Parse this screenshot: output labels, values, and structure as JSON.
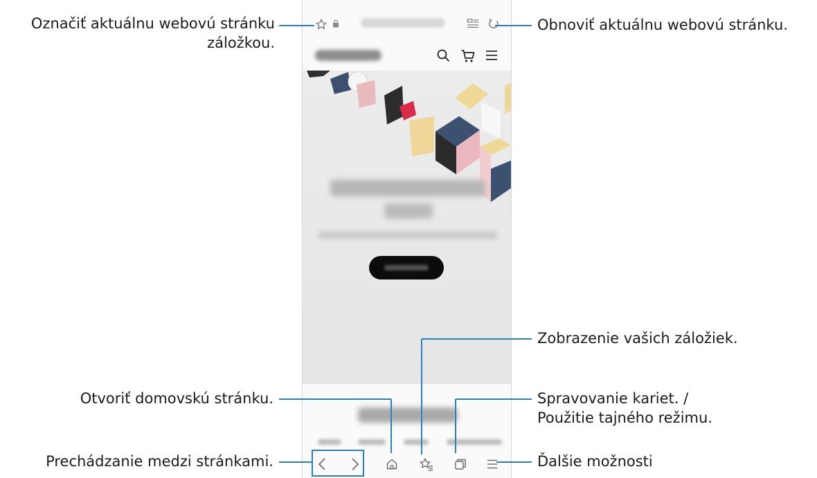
{
  "callouts": {
    "bookmark_current": "Označiť aktuálnu webovú stránku záložkou.",
    "refresh": "Obnoviť aktuálnu webovú stránku.",
    "view_bookmarks": "Zobrazenie vašich záložiek.",
    "home": "Otvoriť domovskú stránku.",
    "tabs_line1": "Spravovanie kariet. /",
    "tabs_line2": "Použitie tajného režimu.",
    "navigate": "Prechádzanie medzi stránkami.",
    "more": "Ďalšie možnosti"
  },
  "colors": {
    "leader": "#2a7fc1",
    "icon": "#777777"
  },
  "icons": {
    "address_bar": [
      "bookmark-star-icon",
      "lock-icon",
      "reader-mode-icon",
      "refresh-icon"
    ],
    "site_header": [
      "search-icon",
      "cart-icon",
      "menu-icon"
    ],
    "bottom_bar": [
      "back-icon",
      "forward-icon",
      "home-icon",
      "bookmarks-icon",
      "tabs-icon",
      "more-menu-icon"
    ]
  },
  "carousel": {
    "total": 4,
    "active": 2,
    "paused": true
  }
}
